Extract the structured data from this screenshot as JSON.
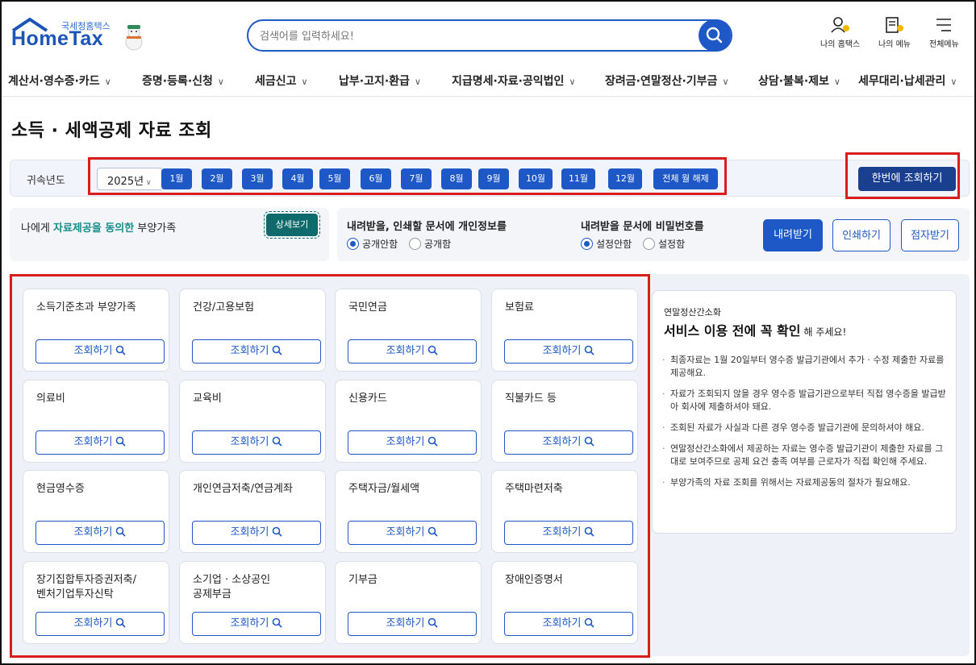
{
  "header": {
    "logo_sub": "국세청홈택스",
    "logo_main": "HomeTax",
    "search_placeholder": "검색어를 입력하세요!",
    "icons": [
      {
        "name": "my-hometax",
        "label": "나의 홈택스"
      },
      {
        "name": "my-menu",
        "label": "나의 메뉴"
      },
      {
        "name": "all-menu",
        "label": "전체메뉴"
      }
    ]
  },
  "nav": [
    "계산서·영수증·카드",
    "증명·등록·신청",
    "세금신고",
    "납부·고지·환급",
    "지급명세·자료·공익법인",
    "장려금·연말정산·기부금",
    "상담·불복·제보",
    "세무대리·납세관리"
  ],
  "page_title": "소득 · 세액공제 자료 조회",
  "filter": {
    "label": "귀속년도",
    "year": "2025년",
    "months": [
      "1월",
      "2월",
      "3월",
      "4월",
      "5월",
      "6월",
      "7월",
      "8월",
      "9월",
      "10월",
      "11월",
      "12월"
    ],
    "clear_label": "전체 월 해제",
    "query_all_label": "한번에 조회하기"
  },
  "dependents": {
    "prefix": "나에게 ",
    "accent": "자료제공을 동의한",
    "suffix": " 부양가족",
    "detail_label": "상세보기"
  },
  "privacy": {
    "title": "내려받을, 인쇄할 문서에 개인정보를",
    "options": [
      "공개안함",
      "공개함"
    ],
    "selected": 0
  },
  "password": {
    "title": "내려받을 문서에 비밀번호를",
    "options": [
      "설정안함",
      "설정함"
    ],
    "selected": 0
  },
  "actions": {
    "download": "내려받기",
    "print": "인쇄하기",
    "braille": "점자받기"
  },
  "categories": [
    "소득기준초과 부양가족",
    "건강/고용보험",
    "국민연금",
    "보험료",
    "의료비",
    "교육비",
    "신용카드",
    "직불카드 등",
    "현금영수증",
    "개인연금저축/연금계좌",
    "주택자금/월세액",
    "주택마련저축",
    "장기집합투자증권저축/\n벤처기업투자신탁",
    "소기업 · 소상공인\n공제부금",
    "기부금",
    "장애인증명서"
  ],
  "category_button_label": "조회하기",
  "info": {
    "sub": "연말정산간소화",
    "head": "서비스 이용 전에 꼭 확인",
    "head_suffix": "해 주세요!",
    "items": [
      "최종자료는 1월 20일부터 영수증 발급기관에서 추가 · 수정 제출한 자료를 제공해요.",
      "자료가 조회되지 않을 경우 영수증 발급기관으로부터 직접 영수증을 발급받아 회사에 제출하셔야 돼요.",
      "조회된 자료가 사실과 다른 경우 영수증 발급기관에 문의하셔야 해요.",
      "연말정산간소화에서 제공하는 자료는 영수증 발급기관이 제출한 자료를 그대로 보여주므로 공제 요건 충족 여부를 근로자가 직접 확인해 주세요.",
      "부양가족의 자료 조회를 위해서는 자료제공동의 절차가 필요해요."
    ]
  },
  "colors": {
    "primary": "#1e57c6",
    "dark": "#1b3f8f",
    "teal": "#1a8c8c",
    "highlight": "#d91c1c"
  }
}
